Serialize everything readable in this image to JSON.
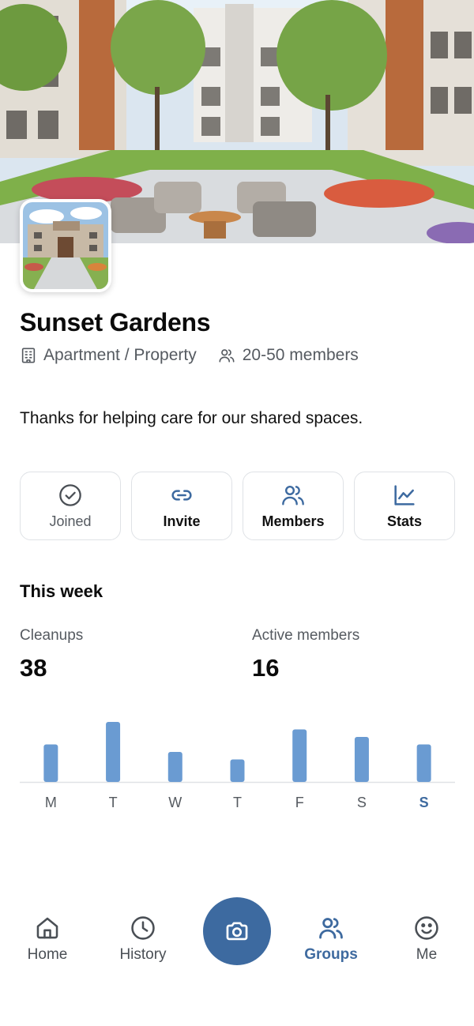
{
  "group": {
    "name": "Sunset Gardens",
    "type": "Apartment / Property",
    "members": "20-50 members",
    "description": "Thanks for helping care for our shared spaces."
  },
  "actions": [
    {
      "label": "Joined",
      "icon": "check-circle-icon"
    },
    {
      "label": "Invite",
      "icon": "link-icon"
    },
    {
      "label": "Members",
      "icon": "users-icon"
    },
    {
      "label": "Stats",
      "icon": "line-chart-icon"
    }
  ],
  "week": {
    "heading": "This week",
    "cleanups_label": "Cleanups",
    "cleanups_value": "38",
    "active_label": "Active members",
    "active_value": "16"
  },
  "chart_data": {
    "type": "bar",
    "categories": [
      "M",
      "T",
      "W",
      "T",
      "F",
      "S",
      "S"
    ],
    "values": [
      5,
      8,
      4,
      3,
      7,
      6,
      5
    ],
    "highlight_index": 6,
    "bar_color": "#6a9bd2",
    "highlight_label_color": "#3e6a9f"
  },
  "nav": [
    {
      "label": "Home",
      "icon": "home-icon"
    },
    {
      "label": "History",
      "icon": "clock-icon"
    },
    {
      "label": "Camera",
      "icon": "camera-icon"
    },
    {
      "label": "Groups",
      "icon": "users-icon",
      "active": true
    },
    {
      "label": "Me",
      "icon": "smile-icon"
    }
  ],
  "colors": {
    "accent": "#3d6aa0",
    "muted": "#555a60",
    "border": "#dfe2e6"
  }
}
